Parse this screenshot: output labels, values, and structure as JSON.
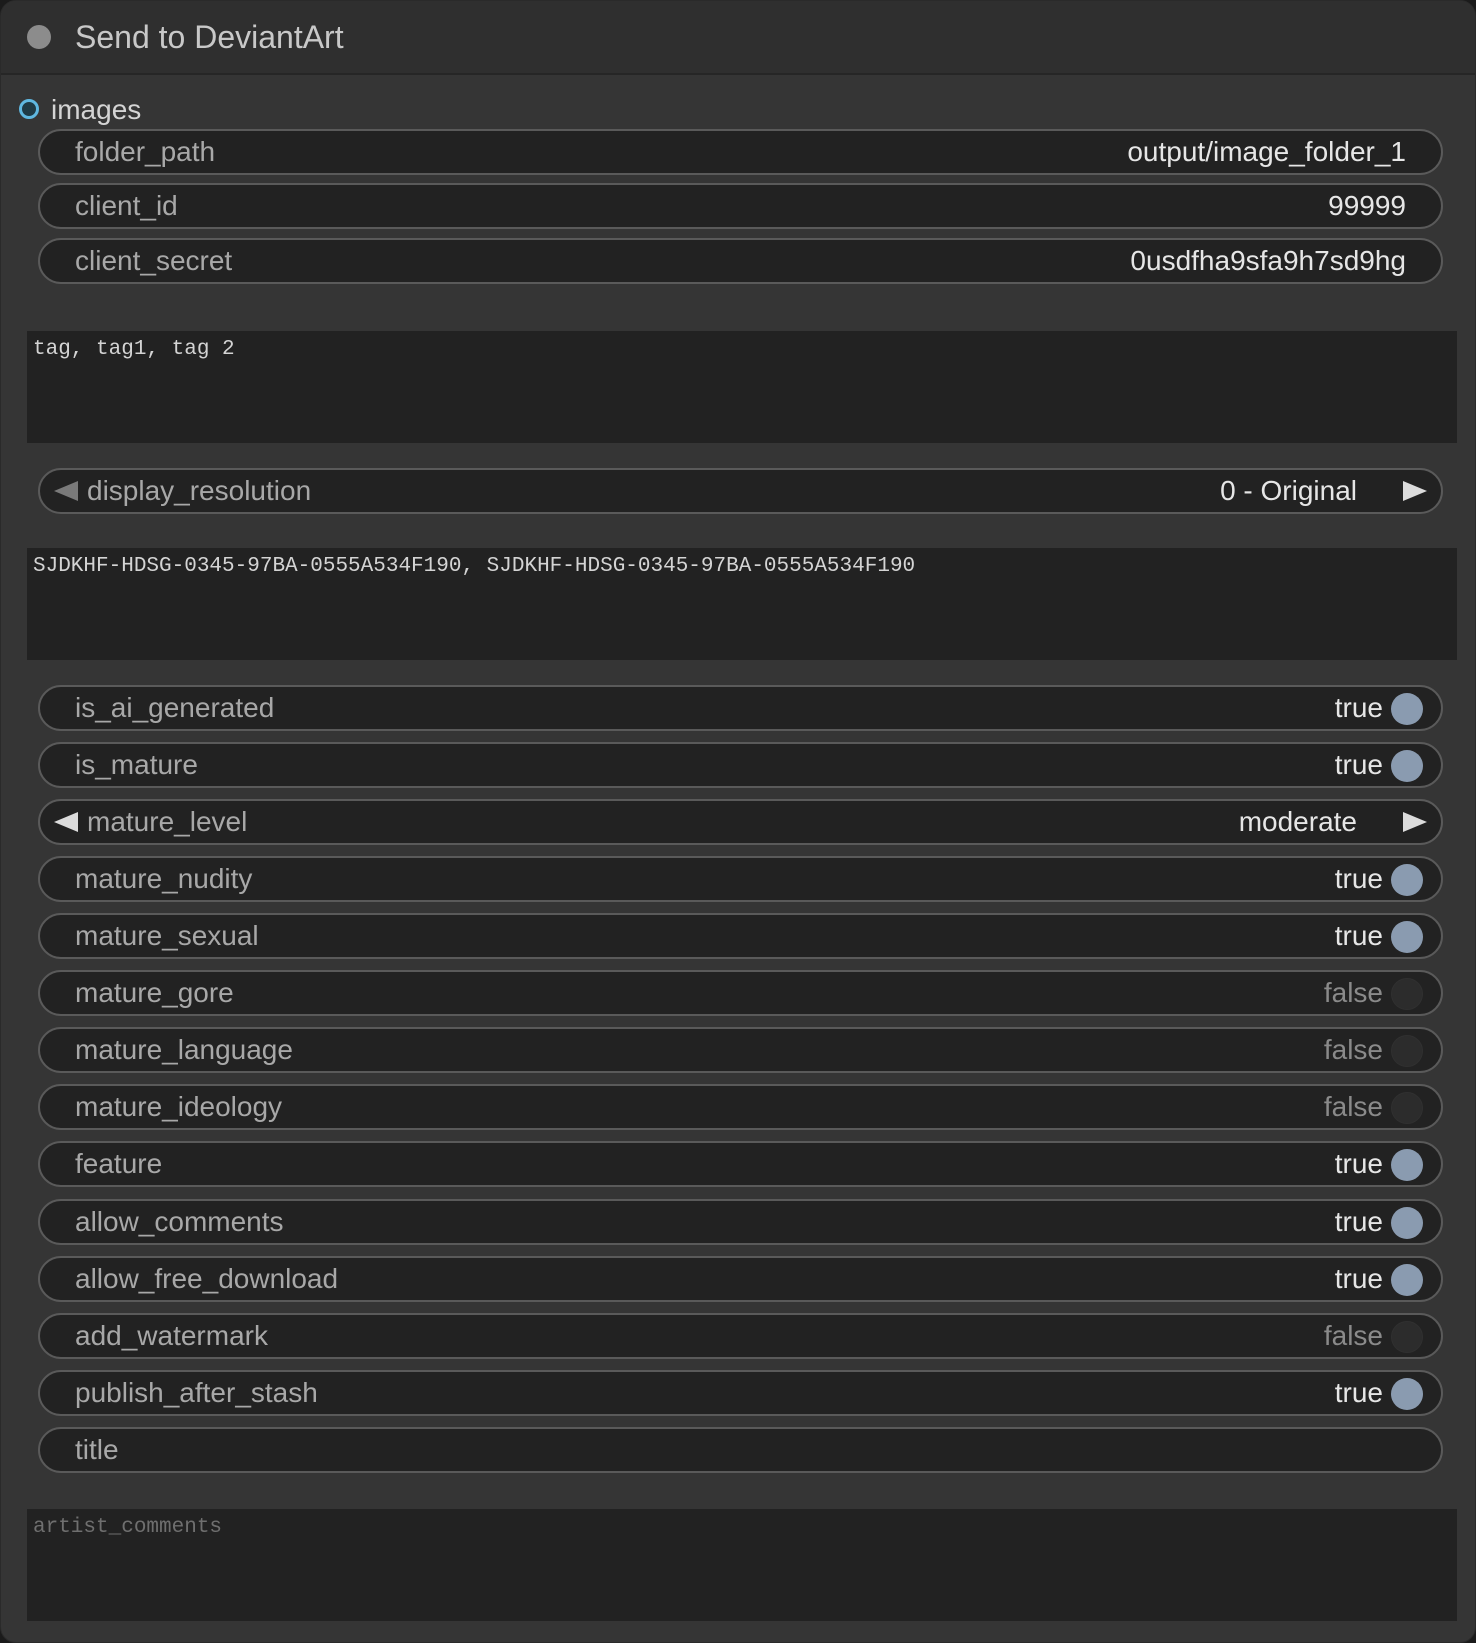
{
  "node": {
    "title": "Send to DeviantArt",
    "input_slot": {
      "label": "images",
      "color": "#5fb7e0"
    }
  },
  "text_widgets": {
    "folder_path": {
      "label": "folder_path",
      "value": "output/image_folder_1"
    },
    "client_id": {
      "label": "client_id",
      "value": "99999"
    },
    "client_secret": {
      "label": "client_secret",
      "value": "0usdfha9sfa9h7sd9hg"
    }
  },
  "tags_textarea": {
    "value": "tag, tag1, tag 2"
  },
  "display_resolution": {
    "label": "display_resolution",
    "value": "0 - Original"
  },
  "ids_textarea": {
    "value": "SJDKHF-HDSG-0345-97BA-0555A534F190, SJDKHF-HDSG-0345-97BA-0555A534F190"
  },
  "toggles_a": [
    {
      "label": "is_ai_generated",
      "value": "true",
      "on": true
    },
    {
      "label": "is_mature",
      "value": "true",
      "on": true
    }
  ],
  "mature_level": {
    "label": "mature_level",
    "value": "moderate"
  },
  "toggles_b": [
    {
      "label": "mature_nudity",
      "value": "true",
      "on": true
    },
    {
      "label": "mature_sexual",
      "value": "true",
      "on": true
    },
    {
      "label": "mature_gore",
      "value": "false",
      "on": false
    },
    {
      "label": "mature_language",
      "value": "false",
      "on": false
    },
    {
      "label": "mature_ideology",
      "value": "false",
      "on": false
    },
    {
      "label": "feature",
      "value": "true",
      "on": true
    },
    {
      "label": "allow_comments",
      "value": "true",
      "on": true
    },
    {
      "label": "allow_free_download",
      "value": "true",
      "on": true
    },
    {
      "label": "add_watermark",
      "value": "false",
      "on": false
    },
    {
      "label": "publish_after_stash",
      "value": "true",
      "on": true
    }
  ],
  "title_widget": {
    "label": "title",
    "value": ""
  },
  "artist_comments": {
    "placeholder": "artist_comments",
    "value": ""
  }
}
